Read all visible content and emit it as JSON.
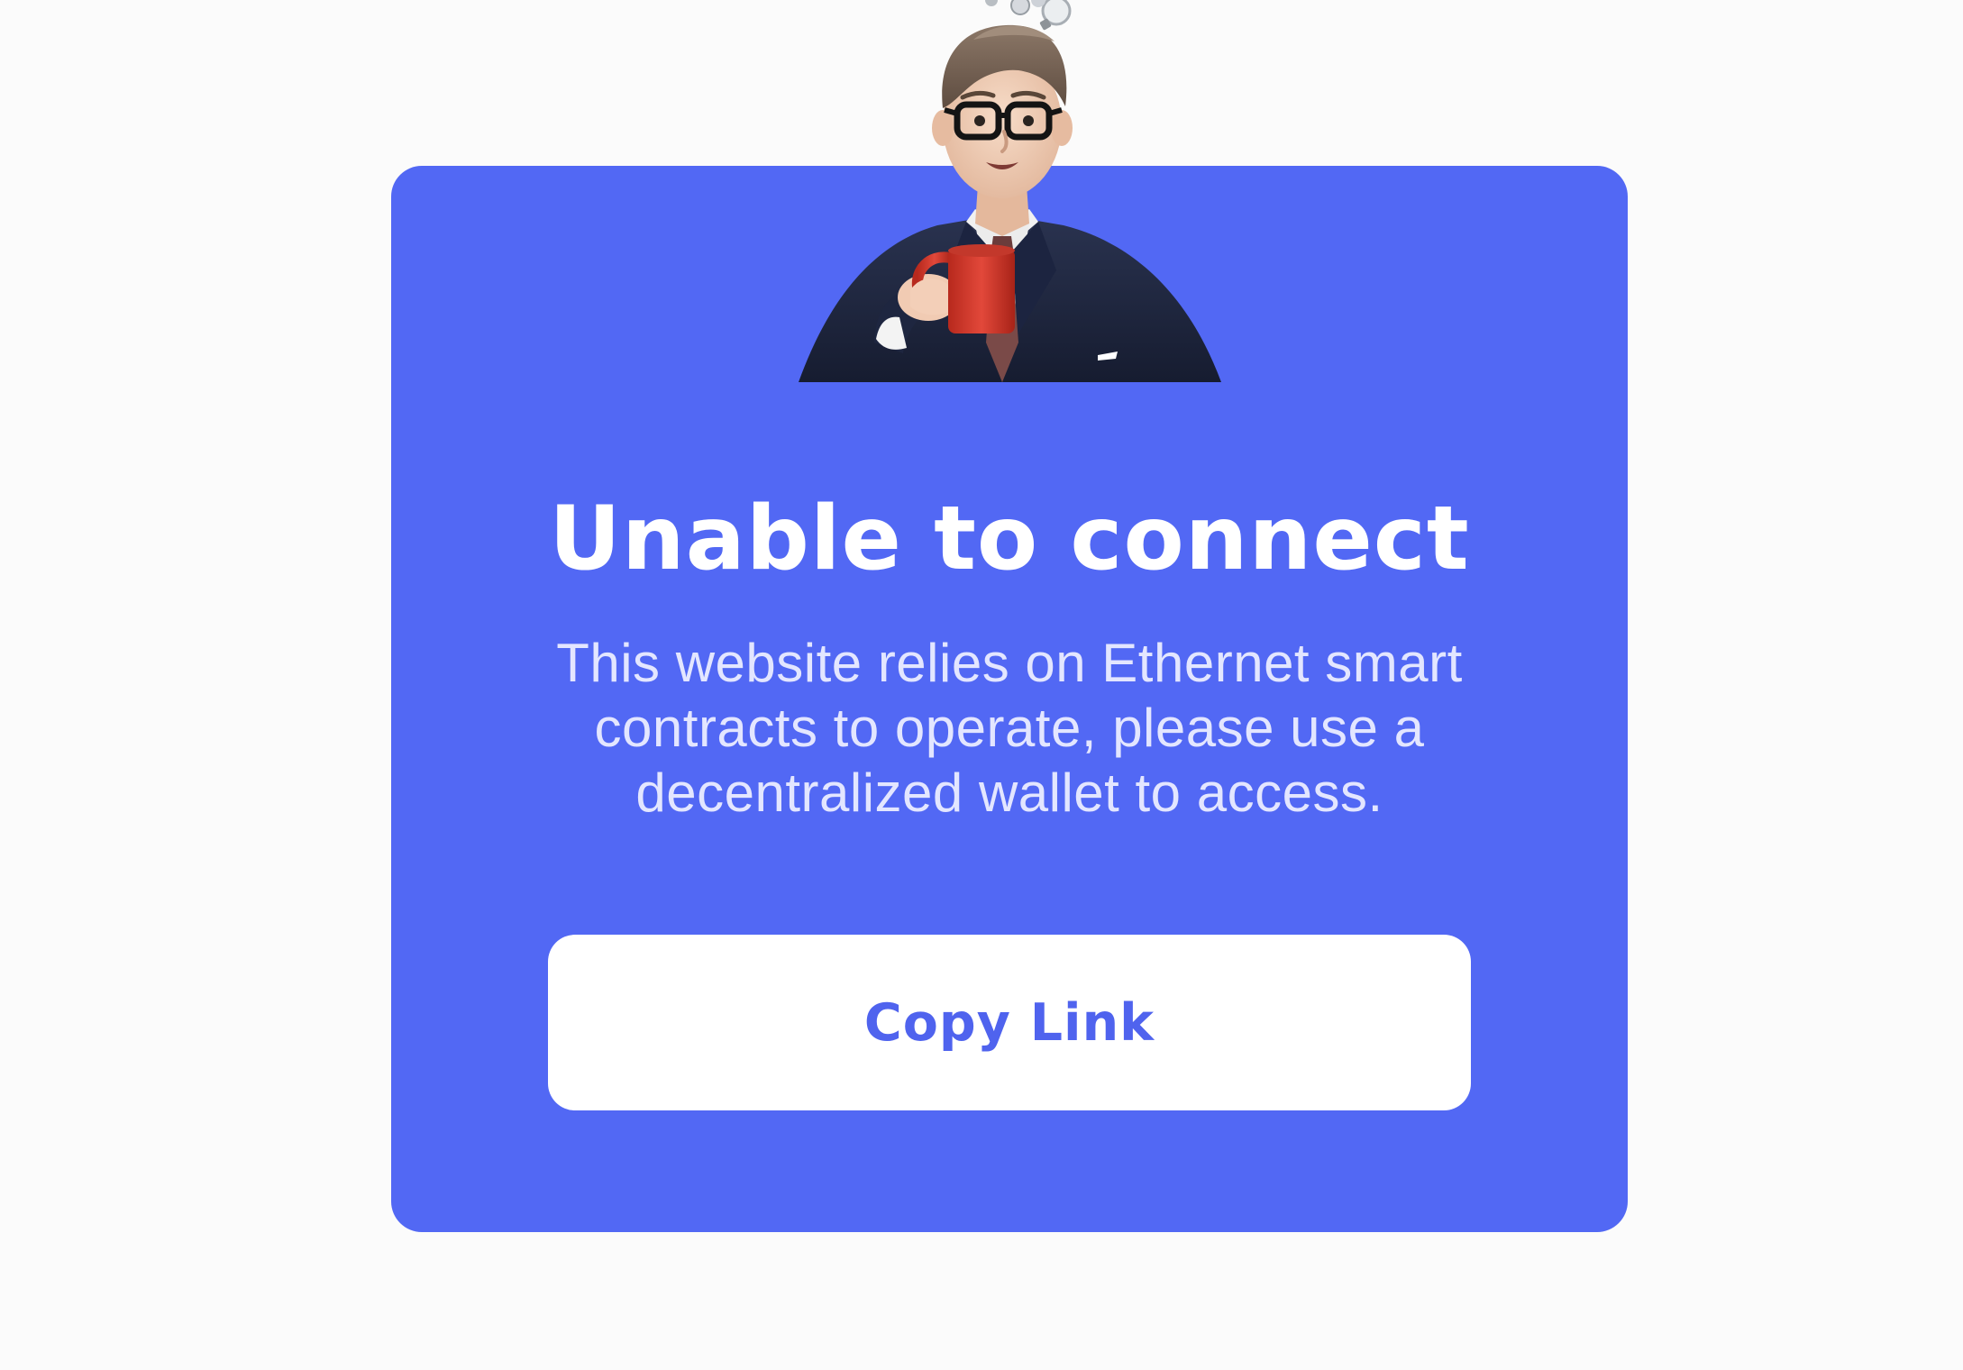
{
  "dialog": {
    "title": "Unable to connect",
    "message": "This website relies on Ethernet smart contracts to operate, please use a decentralized wallet to access.",
    "copy_button_label": "Copy Link",
    "illustration": "businessman-holding-mug-icon"
  },
  "colors": {
    "background": "#fbfbfb",
    "card": "#5268f4",
    "title_text": "#ffffff",
    "message_text": "#e3e6ff",
    "button_background": "#ffffff",
    "button_text": "#4f63ee"
  }
}
